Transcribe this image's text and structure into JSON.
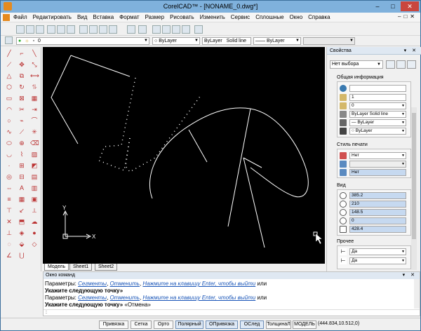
{
  "window": {
    "title": "CorelCAD™ - [NONAME_0.dwg*]"
  },
  "menu": {
    "items": [
      "Файл",
      "Редактировать",
      "Вид",
      "Вставка",
      "Формат",
      "Размер",
      "Рисовать",
      "Изменить",
      "Сервис",
      "Сплошные",
      "Окно",
      "Справка"
    ]
  },
  "layer_bar": {
    "layer_name": "0",
    "color": "ByLayer",
    "linetype": "ByLayer",
    "linetype_style": "Solid line",
    "lineweight": "ByLayer"
  },
  "sheet_tabs": [
    "Модель",
    "Sheet1",
    "Sheet2"
  ],
  "properties": {
    "panel_title": "Свойства",
    "selection": "Нет выбора",
    "general_title": "Общая информация",
    "general": {
      "color_value": "",
      "scale_value": "1",
      "layer": "0",
      "linetype": "ByLayer",
      "linetype_style": "Solid line",
      "lineweight": "ByLayer",
      "line_color": "ByLayer"
    },
    "print_style_title": "Стиль печати",
    "print_style": {
      "style": "Нет",
      "table_value": "",
      "table_type": "Нет"
    },
    "view_title": "Вид",
    "view": {
      "center_x": "385.2",
      "center_y": "210",
      "center_z": "148.5",
      "height": "0",
      "width": "428.4"
    },
    "other_title": "Прочее",
    "other": {
      "ucs_icon_on": "Да",
      "ucs_at_origin": "Да"
    }
  },
  "command_window": {
    "title": "Окно команд",
    "lines": [
      {
        "prefix": "Параметры: ",
        "links": [
          "Сегменты",
          "Отменить",
          "Нажмите на клавишу Enter, чтобы выйти"
        ],
        "suffix": " или"
      },
      {
        "bold": "Укажите следующую точку»"
      },
      {
        "prefix": "Параметры: ",
        "links": [
          "Сегменты",
          "Отменить",
          "Нажмите на клавишу Enter, чтобы выйти"
        ],
        "suffix": " или"
      },
      {
        "bold": "Укажите следующую точку»",
        "suffix": " «Отмена»"
      }
    ],
    "prompt": ":"
  },
  "status": {
    "buttons": [
      "Привязка",
      "Сетка",
      "Орто",
      "Полярный",
      "ОПривязка",
      "ОСлед",
      "ТолщинаЛ",
      "МОДЕЛЬ"
    ],
    "coordinates": "(444.834,10.512,0)"
  },
  "ucs": {
    "x_label": "X",
    "y_label": "Y"
  },
  "colors": {
    "canvas": "#000000",
    "titlebar": "#7fb1dc",
    "close_button": "#c9463d",
    "accent_blue": "#c6d9f0"
  }
}
